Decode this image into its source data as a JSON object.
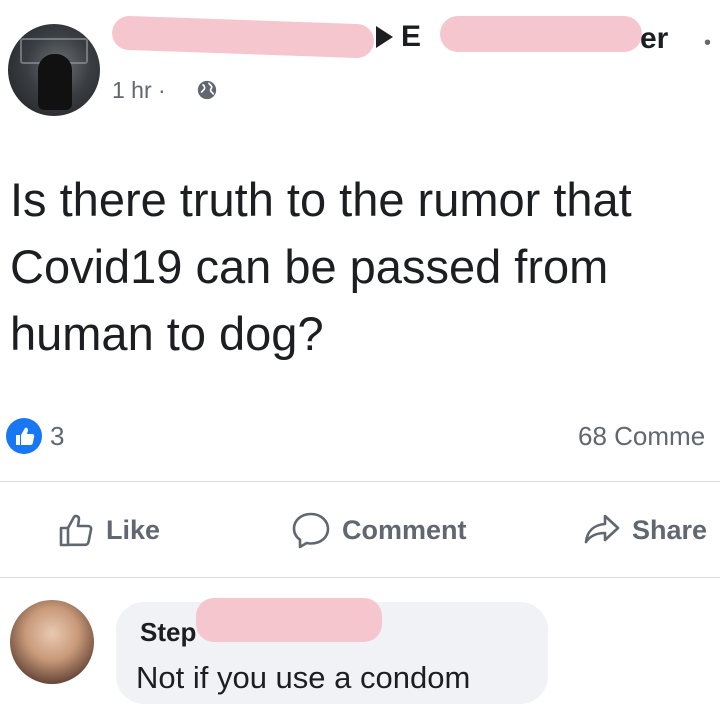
{
  "post": {
    "author_fragment_start": "E",
    "author_fragment_end": "er",
    "more_icon": "more-dots-icon",
    "timestamp": "1 hr",
    "separator": "·",
    "audience_icon": "globe-icon",
    "text": "Is there truth to the rumor that\nCovid19 can be passed from\nhuman to dog?"
  },
  "stats": {
    "reaction_icon": "thumbs-up-badge-icon",
    "reactions": "3",
    "comments": "68 Comme"
  },
  "actions": {
    "like": "Like",
    "comment": "Comment",
    "share": "Share"
  },
  "comment": {
    "author_fragment": "Step",
    "text": "Not if you use a condom"
  },
  "colors": {
    "brand_blue": "#1877f2",
    "redaction_pink": "#f6c6cf",
    "secondary_text": "#606770",
    "bubble_bg": "#f0f2f5"
  }
}
